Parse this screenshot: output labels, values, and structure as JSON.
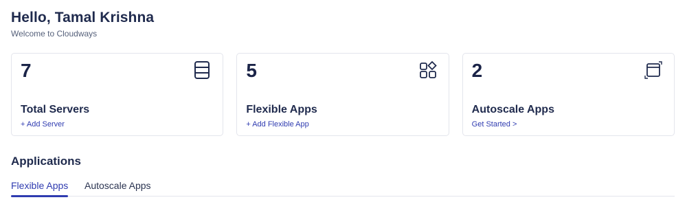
{
  "greeting": {
    "title": "Hello, Tamal Krishna",
    "subtitle": "Welcome to Cloudways"
  },
  "cards": [
    {
      "count": "7",
      "title": "Total Servers",
      "action": "+ Add Server",
      "icon": "server-icon"
    },
    {
      "count": "5",
      "title": "Flexible Apps",
      "action": "+ Add Flexible App",
      "icon": "apps-grid-icon"
    },
    {
      "count": "2",
      "title": "Autoscale Apps",
      "action": "Get Started >",
      "icon": "autoscale-window-icon"
    }
  ],
  "applications": {
    "title": "Applications",
    "tabs": [
      {
        "label": "Flexible Apps",
        "active": true
      },
      {
        "label": "Autoscale Apps",
        "active": false
      }
    ]
  },
  "colors": {
    "accent": "#2f3bb0",
    "text": "#1f2a4d",
    "border": "#e3e5ec"
  }
}
